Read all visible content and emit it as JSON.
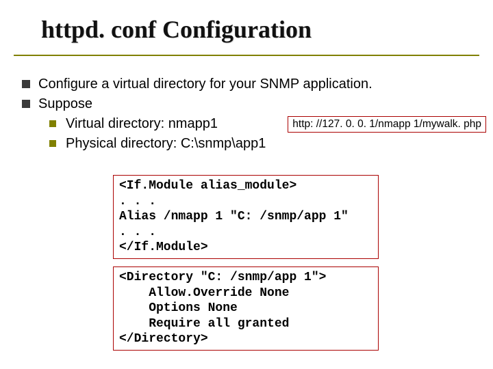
{
  "title": "httpd. conf Configuration",
  "bullets": {
    "b1a": "Configure a virtual directory for your SNMP application.",
    "b1b": "Suppose",
    "b2a": "Virtual directory: nmapp1",
    "b2b": "Physical directory: C:\\snmp\\app1"
  },
  "url_box": "http: //127. 0. 0. 1/nmapp 1/mywalk. php",
  "code1": "<If.Module alias_module>\n. . .\nAlias /nmapp 1 \"C: /snmp/app 1\"\n. . .\n</If.Module>",
  "code2": "<Directory \"C: /snmp/app 1\">\n    Allow.Override None\n    Options None\n    Require all granted\n</Directory>"
}
